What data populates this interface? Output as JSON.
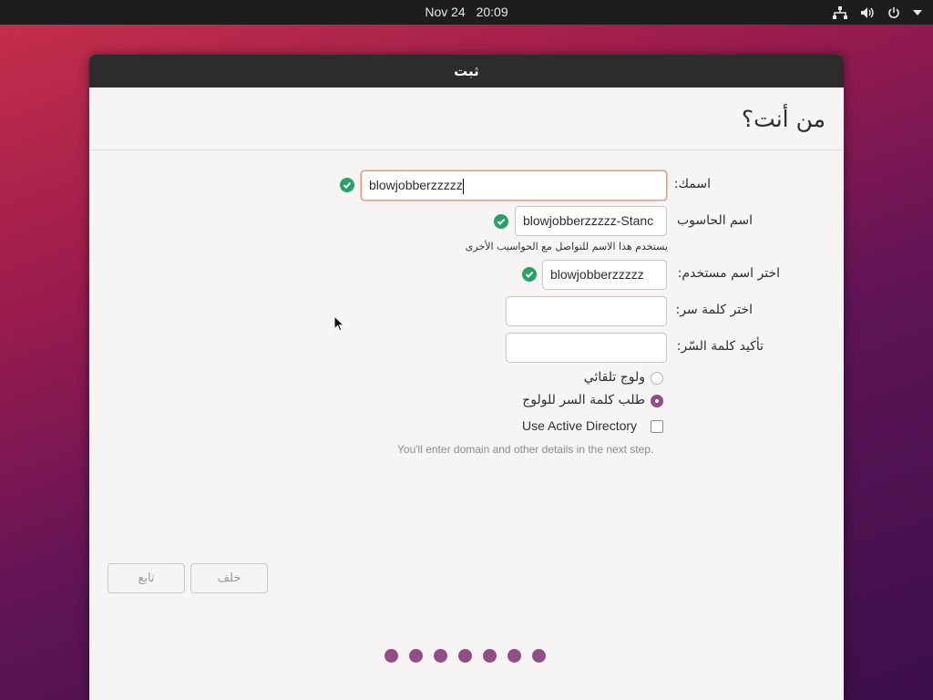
{
  "topbar": {
    "date": "Nov 24",
    "time": "20:09"
  },
  "window": {
    "title": "ثبت",
    "heading": "من أنت؟",
    "name": {
      "label": "اسمك:",
      "value": "blowjobberzzzzz"
    },
    "computer": {
      "label": "اسم الحاسوب",
      "value": "blowjobberzzzzz-Stanc",
      "hint": "يستخدم هذا الاسم للتواصل مع الحواسيب الأخرى"
    },
    "username": {
      "label": "اختر اسم مستخدم:",
      "value": "blowjobberzzzzz"
    },
    "password": {
      "label": "اختر كلمة سر:",
      "value": ""
    },
    "confirm": {
      "label": "تأكيد كلمة السّر:",
      "value": ""
    },
    "login_auto": {
      "label": "ولوج تلقائي",
      "selected": false
    },
    "login_password": {
      "label": "طلب كلمة السر للولوج",
      "selected": true
    },
    "active_directory": {
      "label": "Use Active Directory",
      "checked": false,
      "note": "You'll enter domain and other details in the next step."
    },
    "buttons": {
      "back": "خلف",
      "continue": "تابع"
    },
    "progress": {
      "steps": 7
    }
  },
  "colors": {
    "accent": "#934d86",
    "check": "#26a269",
    "focus": "#e9967a"
  }
}
